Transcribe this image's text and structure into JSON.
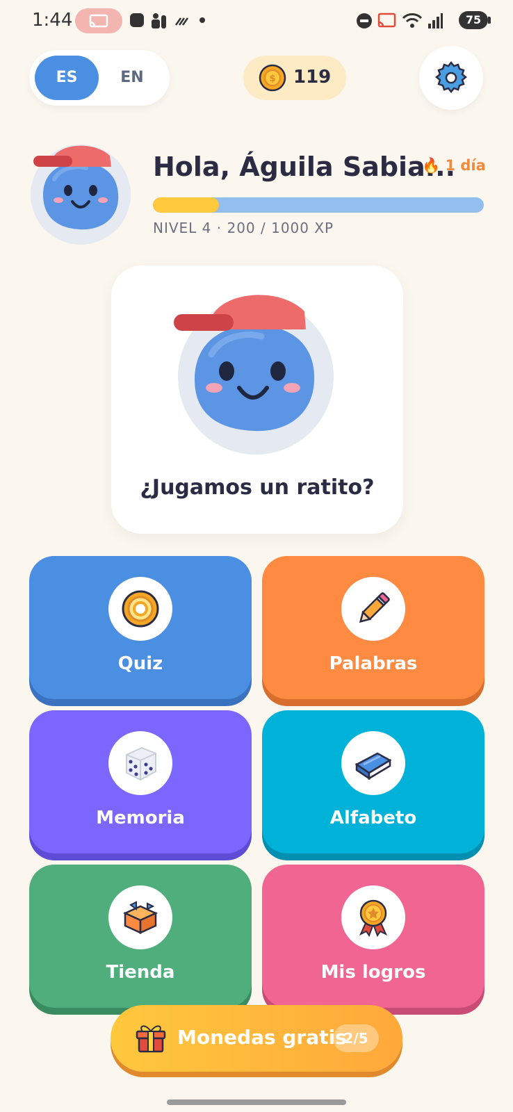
{
  "status_bar": {
    "time": "1:44",
    "battery": "75"
  },
  "header": {
    "languages": [
      "ES",
      "EN"
    ],
    "active_language": "ES",
    "coins": "119",
    "settings_icon": "gear-icon"
  },
  "profile": {
    "greeting": "Hola, Águila Sabia...",
    "streak": "1 día",
    "level_text": "NIVEL 4 · 200 / 1000 XP",
    "xp_progress": 0.2
  },
  "hero": {
    "prompt": "¿Jugamos un ratito?"
  },
  "tiles": [
    {
      "label": "Quiz",
      "icon": "target-icon",
      "color": "#4A8FE2",
      "shadow": "#3B72C0"
    },
    {
      "label": "Palabras",
      "icon": "pencil-icon",
      "color": "#FF8A42",
      "shadow": "#D86E2E"
    },
    {
      "label": "Memoria",
      "icon": "dice-icon",
      "color": "#7B66FF",
      "shadow": "#5E4CD6"
    },
    {
      "label": "Alfabeto",
      "icon": "book-icon",
      "color": "#00B2D8",
      "shadow": "#008FB0"
    },
    {
      "label": "Tienda",
      "icon": "box-icon",
      "color": "#4FAE7B",
      "shadow": "#3A8C60"
    },
    {
      "label": "Mis logros",
      "icon": "medal-icon",
      "color": "#F06592",
      "shadow": "#C84C76"
    }
  ],
  "free_coins": {
    "label": "Monedas gratis",
    "count": "2/5"
  },
  "colors": {
    "background": "#FBF7EE",
    "accent": "#4A8FE2",
    "xp_fill": "#FFC83D",
    "streak": "#F08A3C"
  }
}
